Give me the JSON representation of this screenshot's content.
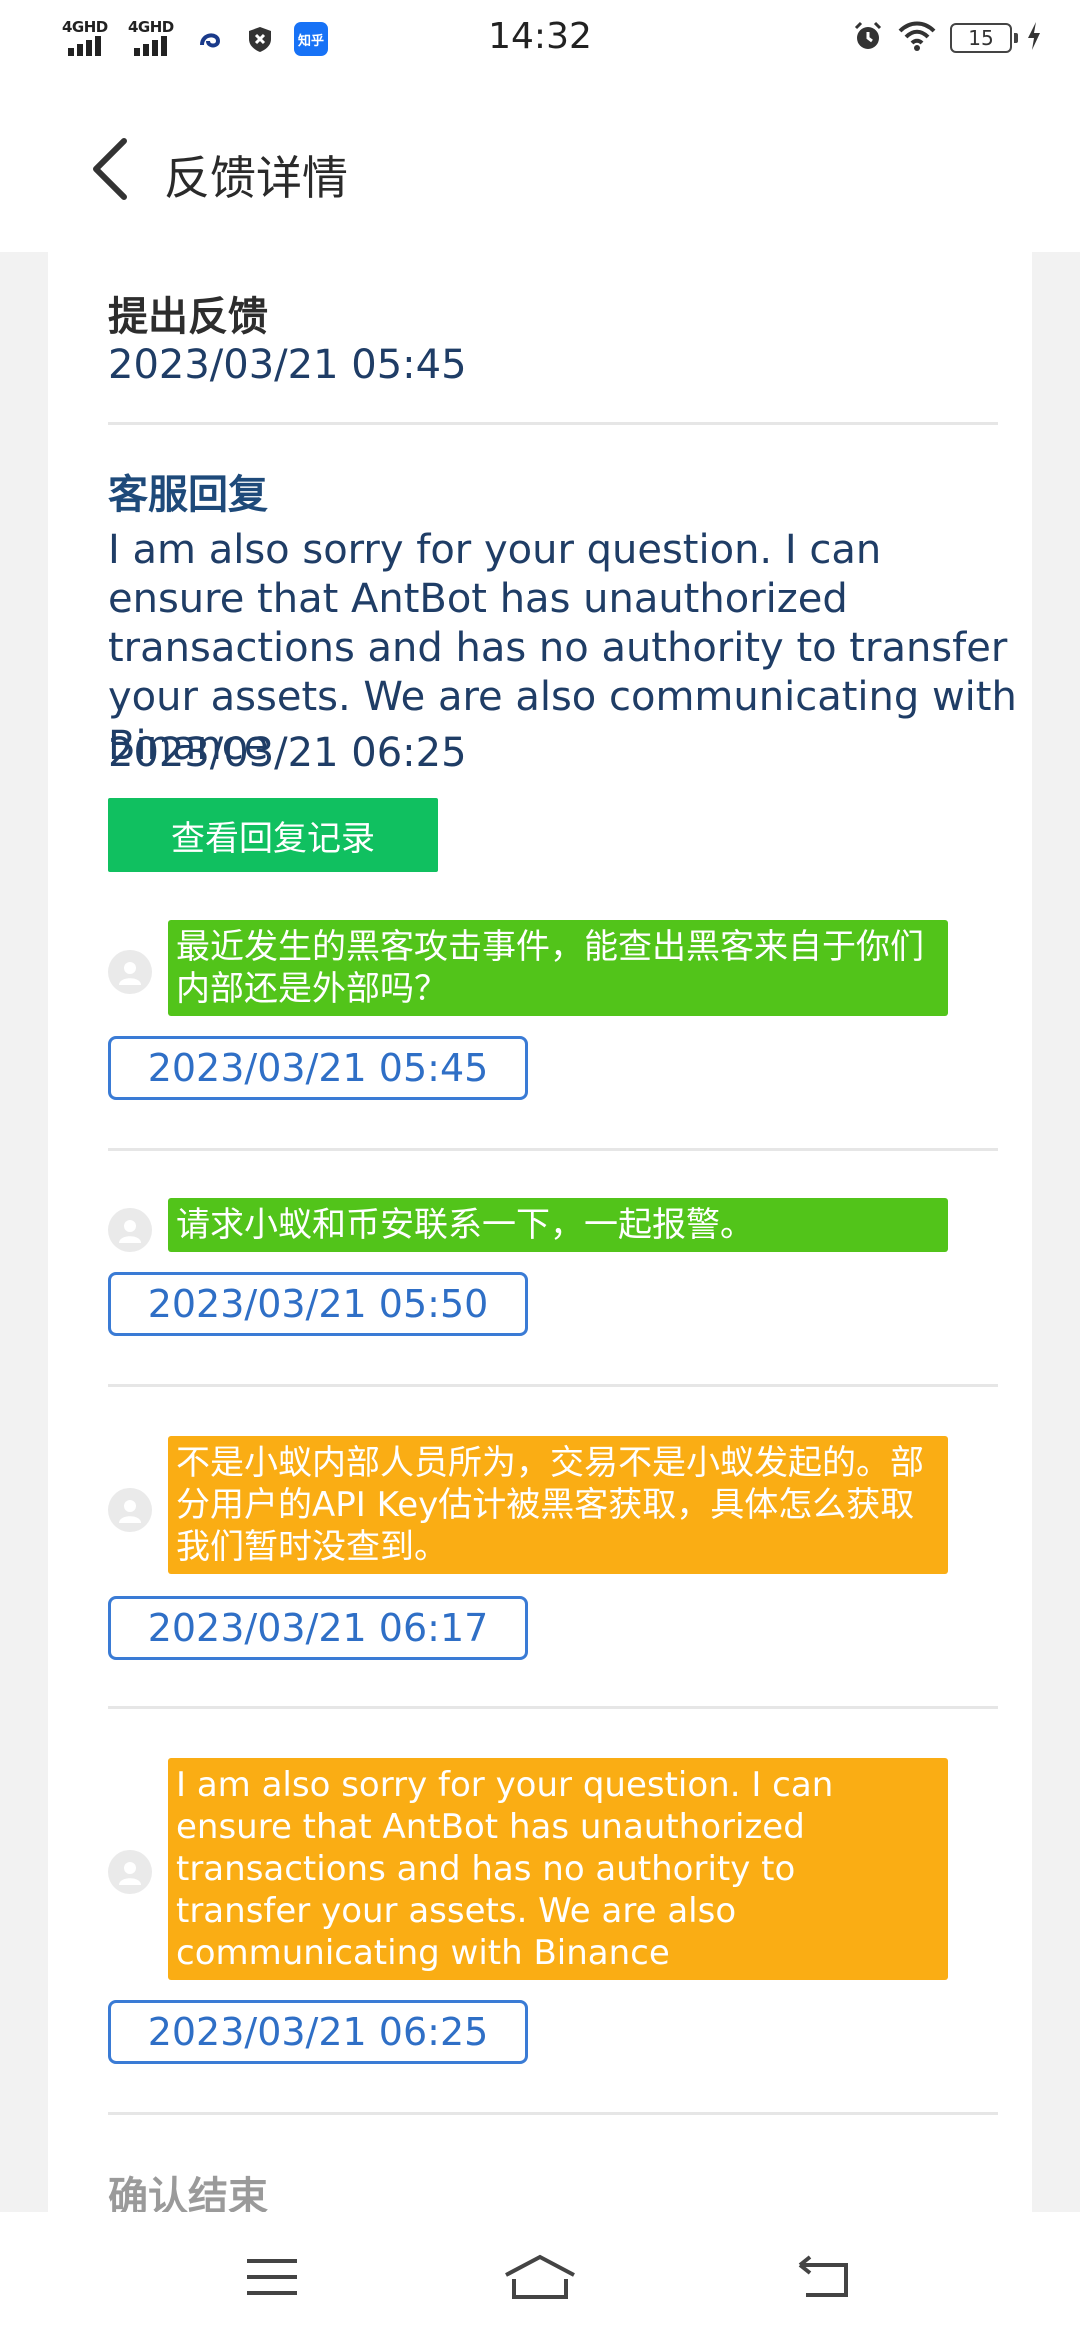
{
  "status_bar": {
    "time": "14:32",
    "signal_1_label": "4GHD",
    "signal_2_label": "4GHD",
    "zhihu_label": "知乎",
    "battery_level": "15"
  },
  "header": {
    "title": "反馈详情"
  },
  "feedback": {
    "heading": "提出反馈",
    "date": "2023/03/21 05:45"
  },
  "reply": {
    "heading": "客服回复",
    "text": "I am also sorry for your question. I can ensure that AntBot has unauthorized transactions and has no authority to transfer your assets. We are also communicating with Binance",
    "date": "2023/03/21 06:25",
    "view_button_label": "查看回复记录"
  },
  "messages": [
    {
      "text": "最近发生的黑客攻击事件，能查出黑客来自于你们内部还是外部吗？",
      "time": "2023/03/21 05:45",
      "color": "#52c41a"
    },
    {
      "text": "请求小蚁和币安联系一下，一起报警。",
      "time": "2023/03/21 05:50",
      "color": "#52c41a"
    },
    {
      "text": "不是小蚁内部人员所为，交易不是小蚁发起的。部分用户的API Key估计被黑客获取，具体怎么获取我们暂时没查到。",
      "time": "2023/03/21 06:17",
      "color": "#faad14"
    },
    {
      "text": "I am also sorry for your question. I can ensure that AntBot has unauthorized transactions and has no authority to transfer your assets. We are also communicating with Binance",
      "time": "2023/03/21 06:25",
      "color": "#faad14"
    }
  ],
  "footer": {
    "confirm_label": "确认结束"
  },
  "icons": {
    "back": "chevron-left-icon",
    "avatar": "user-avatar-icon",
    "nav_menu": "menu-icon",
    "nav_home": "home-icon",
    "nav_back": "back-icon"
  }
}
